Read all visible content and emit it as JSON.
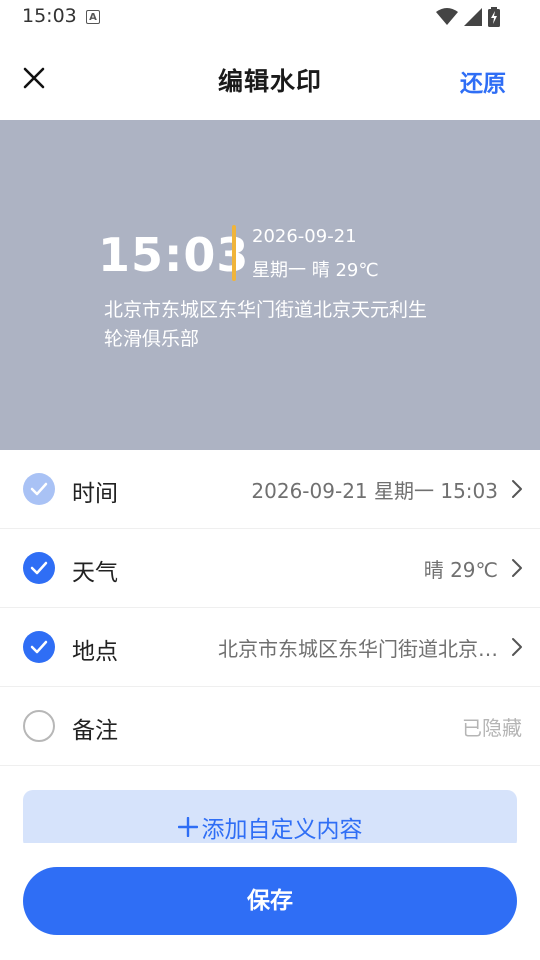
{
  "status_bar": {
    "time": "15:03",
    "notification_icon": "A"
  },
  "header": {
    "title": "编辑水印",
    "restore_label": "还原"
  },
  "preview": {
    "time": "15:03",
    "date": "2026-09-21",
    "weekday_weather": "星期一   晴 29℃",
    "address": "北京市东城区东华门街道北京天元利生轮滑俱乐部",
    "divider_color": "#f0b43a"
  },
  "options": [
    {
      "label": "时间",
      "value": "2026-09-21 星期一 15:03",
      "state": "checked-disabled"
    },
    {
      "label": "天气",
      "value": "晴 29℃",
      "state": "checked"
    },
    {
      "label": "地点",
      "value": "北京市东城区东华门街道北京…",
      "state": "checked"
    },
    {
      "label": "备注",
      "value": "已隐藏",
      "state": "unchecked"
    }
  ],
  "add_custom_label": "添加自定义内容",
  "save_label": "保存",
  "colors": {
    "accent": "#2f6ef5",
    "preview_bg": "#adb3c3"
  }
}
